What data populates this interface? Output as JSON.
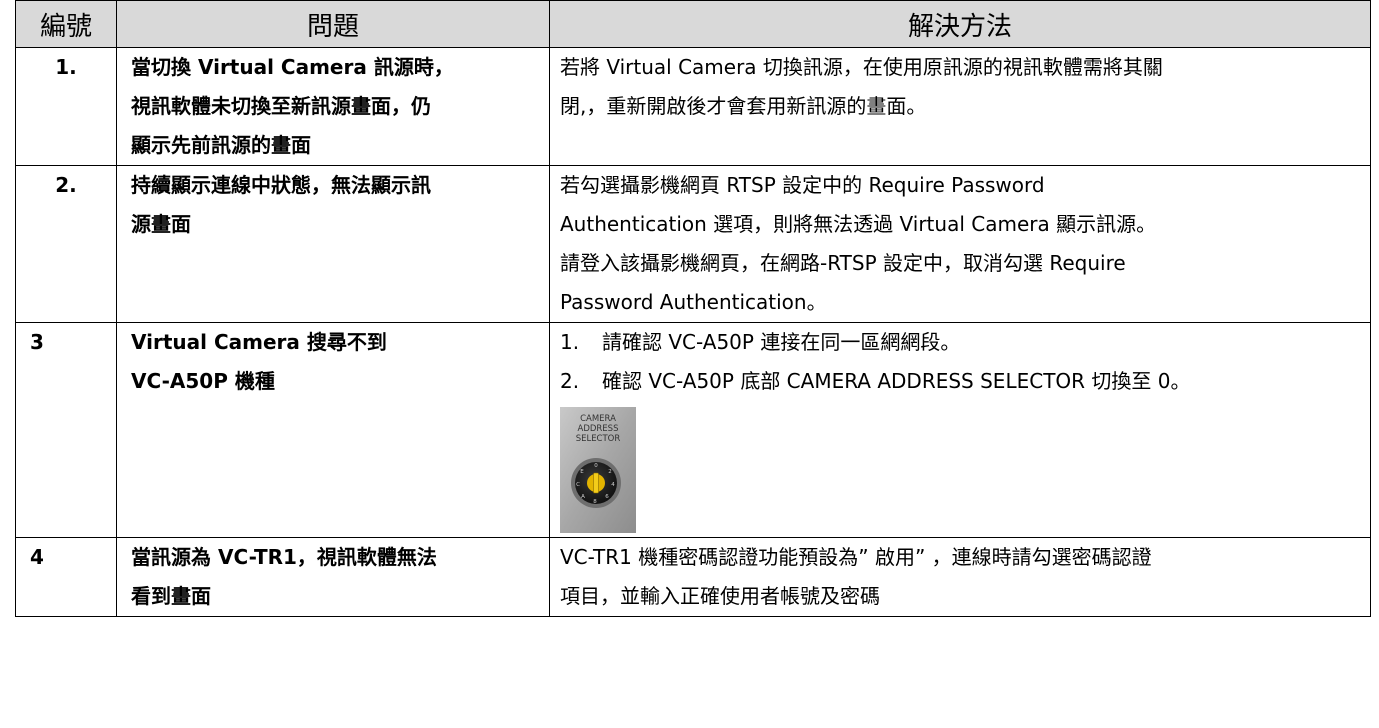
{
  "headers": {
    "number": "編號",
    "problem": "問題",
    "solution": "解決方法"
  },
  "rows": [
    {
      "number": "1.",
      "problem_lines": [
        "當切換 Virtual Camera 訊源時，",
        "視訊軟體未切換至新訊源畫面，仍",
        "顯示先前訊源的畫面"
      ],
      "solution_lines": [
        "若將 Virtual Camera 切換訊源，在使用原訊源的視訊軟體需將其關",
        "閉,，重新開啟後才會套用新訊源的畫面。"
      ]
    },
    {
      "number": "2.",
      "problem_lines": [
        "持續顯示連線中狀態，無法顯示訊",
        "源畫面"
      ],
      "solution_lines": [
        "若勾選攝影機網頁 RTSP 設定中的 Require Password",
        "Authentication 選項，則將無法透過 Virtual Camera 顯示訊源。",
        "請登入該攝影機網頁，在網路-RTSP 設定中，取消勾選 Require",
        "Password Authentication。"
      ]
    },
    {
      "number": "3",
      "problem_lines": [
        "Virtual Camera 搜尋不到",
        "VC-A50P 機種"
      ],
      "solution_items": [
        {
          "marker": "1.",
          "text": "請確認 VC-A50P 連接在同一區網網段。"
        },
        {
          "marker": "2.",
          "text": "確認 VC-A50P 底部 CAMERA ADDRESS SELECTOR 切換至 0。"
        }
      ],
      "photo_label": [
        "CAMERA",
        "ADDRESS",
        "SELECTOR"
      ]
    },
    {
      "number": "4",
      "problem_lines": [
        "當訊源為 VC-TR1，視訊軟體無法",
        "看到畫面"
      ],
      "solution_lines": [
        "VC-TR1 機種密碼認證功能預設為” 啟用” ，連線時請勾選密碼認證",
        "項目，並輸入正確使用者帳號及密碼"
      ]
    }
  ]
}
